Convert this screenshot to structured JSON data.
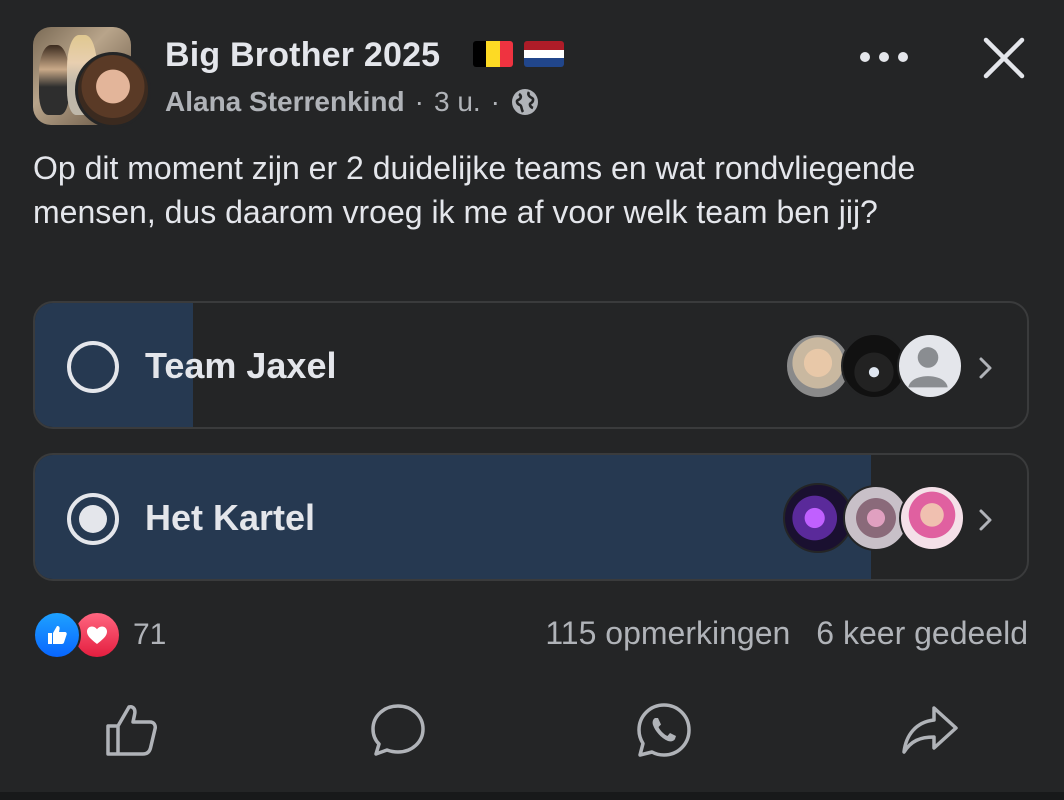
{
  "header": {
    "group_name": "Big Brother 2025",
    "author": "Alana Sterrenkind",
    "time": "3 u.",
    "separator": "·",
    "flags": [
      "belgium-flag",
      "netherlands-flag"
    ]
  },
  "post": {
    "text": "Op dit moment zijn er 2 duidelijke teams en wat rondvliegende mensen, dus daarom vroeg ik me af voor welk team ben jij?"
  },
  "poll": {
    "options": [
      {
        "label": "Team Jaxel",
        "selected": false,
        "share": 0.16
      },
      {
        "label": "Het Kartel",
        "selected": true,
        "share": 0.84
      }
    ]
  },
  "footer": {
    "reaction_count": "71",
    "comments": "115 opmerkingen",
    "shares": "6 keer gedeeld"
  },
  "colors": {
    "background": "#242526",
    "poll_fill": "#263951",
    "text": "#e4e6eb",
    "secondary_text": "#b0b3b8"
  }
}
